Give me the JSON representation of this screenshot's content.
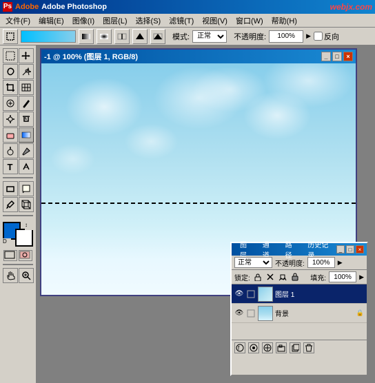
{
  "app": {
    "title": "Adobe Photoshop",
    "icon": "Ps",
    "webjx": "webjx.com"
  },
  "menubar": {
    "items": [
      {
        "label": "文件(F)"
      },
      {
        "label": "编辑(E)"
      },
      {
        "label": "图像(I)"
      },
      {
        "label": "图层(L)"
      },
      {
        "label": "选择(S)"
      },
      {
        "label": "滤镜(T)"
      },
      {
        "label": "视图(V)"
      },
      {
        "label": "窗口(W)"
      },
      {
        "label": "帮助(H)"
      }
    ]
  },
  "optionsbar": {
    "mode_label": "模式:",
    "mode_value": "正常",
    "opacity_label": "不透明度:",
    "opacity_value": "100%",
    "reverse_label": "反向"
  },
  "document": {
    "title": "-1 @ 100% (图层 1, RGB/8)",
    "controls": [
      "_",
      "□",
      "×"
    ]
  },
  "layers_panel": {
    "title_tabs": [
      "图层",
      "通道",
      "路径",
      "历史记录"
    ],
    "active_tab": "图层",
    "mode_label": "正常",
    "opacity_label": "不透明度:",
    "opacity_value": "100%",
    "lock_label": "锁定:",
    "fill_label": "填充:",
    "fill_value": "100%",
    "layers": [
      {
        "name": "图层 1",
        "visible": true,
        "active": true,
        "locked": false
      },
      {
        "name": "背景",
        "visible": true,
        "active": false,
        "locked": true
      }
    ],
    "bottom_buttons": [
      "fx",
      "○",
      "□",
      "fx",
      "🗑"
    ]
  },
  "toolbar": {
    "tools": [
      [
        "marquee",
        "move"
      ],
      [
        "lasso",
        "magic-wand"
      ],
      [
        "crop",
        "slice"
      ],
      [
        "heal",
        "brush"
      ],
      [
        "clone",
        "history"
      ],
      [
        "eraser",
        "gradient"
      ],
      [
        "dodge",
        "pen"
      ],
      [
        "text",
        "path"
      ],
      [
        "zoom",
        "hand"
      ]
    ],
    "fg_color": "#0066cc",
    "bg_color": "#ffffff"
  }
}
